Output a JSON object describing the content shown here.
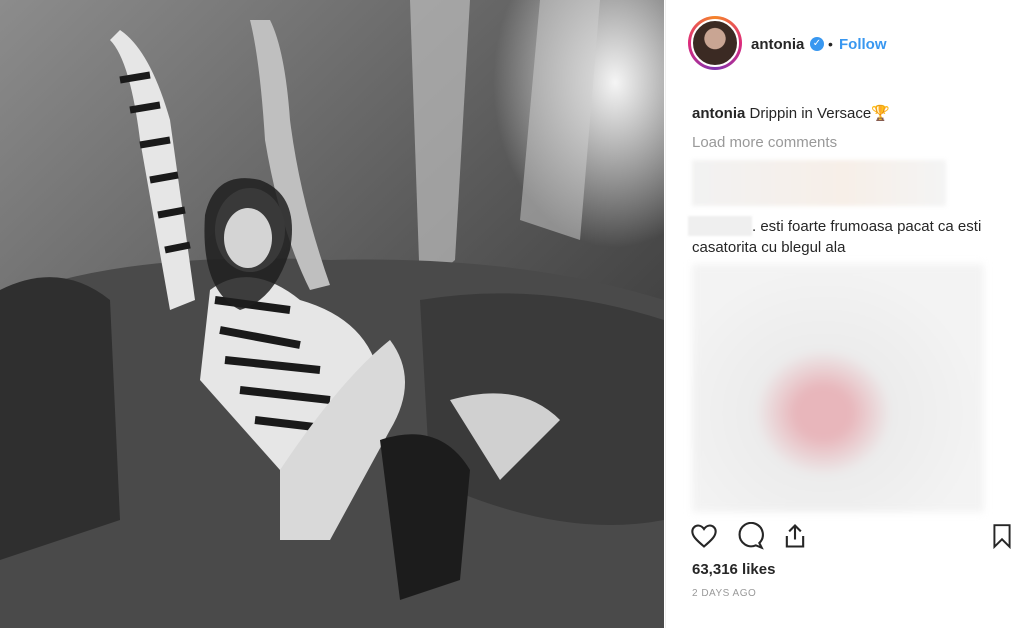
{
  "post": {
    "username": "antonia",
    "follow_label": "Follow",
    "separator": "•",
    "caption": "Drippin in Versace",
    "load_more": "Load more comments",
    "comment_text": ". esti foarte frumoasa pacat ca esti casatorita cu blegul ala",
    "likes": "63,316 likes",
    "date": "2 DAYS AGO"
  },
  "icons": {
    "verified": "verified-badge-icon",
    "trophy": "trophy-icon",
    "like": "heart-icon",
    "comment": "comment-icon",
    "share": "share-icon",
    "save": "bookmark-icon"
  },
  "colors": {
    "accent": "#3897f0",
    "text": "#262626",
    "muted": "#999999"
  }
}
